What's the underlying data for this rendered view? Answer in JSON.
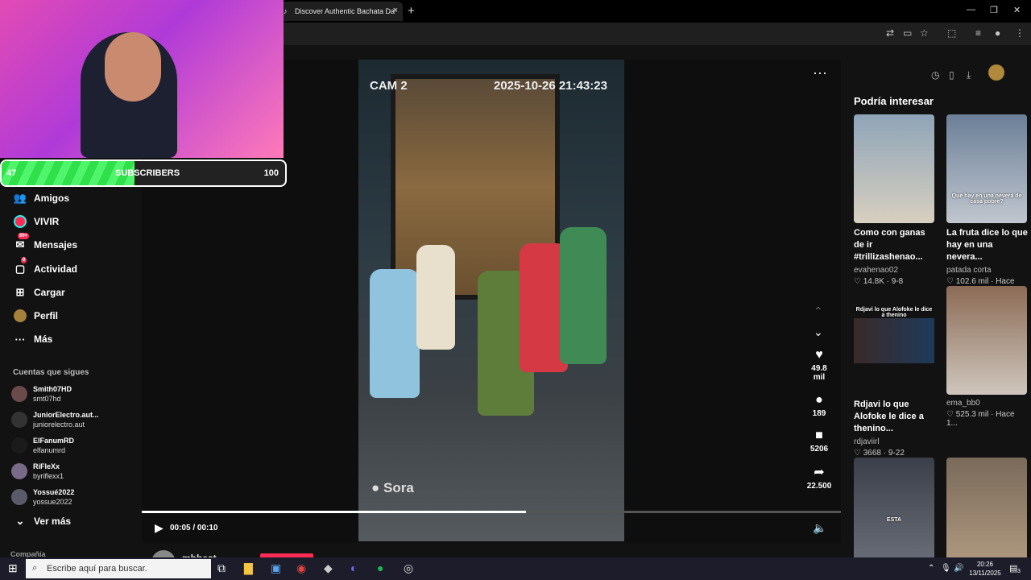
{
  "browser": {
    "tab_title": "Discover Authentic Bachata Da",
    "tab_close": "×",
    "new_tab": "+"
  },
  "sidebar": {
    "items": [
      {
        "label": "Amigos",
        "icon": "friends-icon"
      },
      {
        "label": "VIVIR",
        "icon": "live-icon"
      },
      {
        "label": "Mensajes",
        "icon": "messages-icon",
        "badge": "99+"
      },
      {
        "label": "Actividad",
        "icon": "activity-icon",
        "badge": "8"
      },
      {
        "label": "Cargar",
        "icon": "upload-icon"
      },
      {
        "label": "Perfil",
        "icon": "profile-icon"
      },
      {
        "label": "Más",
        "icon": "more-icon"
      }
    ],
    "following_heading": "Cuentas que sigues",
    "accounts": [
      {
        "name": "Smith07HD",
        "handle": "smt07hd"
      },
      {
        "name": "JuniorElectro.aut...",
        "handle": "juniorelectro.aut"
      },
      {
        "name": "ElFanumRD",
        "handle": "elfanumrd"
      },
      {
        "name": "RiFleXx",
        "handle": "byriflexx1"
      },
      {
        "name": "Yossué2022",
        "handle": "yossue2022"
      }
    ],
    "see_more": "Ver más",
    "footer": "Compañía"
  },
  "video": {
    "cam_label": "CAM 2",
    "timestamp": "2025-10-26 21:43:23",
    "watermark": "Sora",
    "likes": "49.8\nmil",
    "comments": "189",
    "saves": "5206",
    "shares": "22.500",
    "current_time": "00:05",
    "duration": "00:10",
    "time_display": "00:05 / 00:10",
    "progress": 0.55,
    "creator": "mbbeat"
  },
  "right_panel": {
    "heading": "Podría interesar",
    "cards": [
      {
        "title": "Como con ganas de ir #trillizashenao...",
        "author": "evahenao02",
        "stats": "♡ 14.8K · 9-8",
        "overlay": "",
        "color": "#8ea4b8"
      },
      {
        "title": "La fruta dice lo que hay en una nevera...",
        "author": "patada corta",
        "stats": "♡ 102.6 mil · Hace 1...",
        "overlay": "Que hay en una nevera de casa pobre?",
        "color": "#6b7f97"
      },
      {
        "title": "Rdjavi lo que Alofoke le dice a thenino...",
        "author": "rdjaviirl",
        "stats": "♡ 3668 · 9-22",
        "overlay": "Rdjavi lo que Alofoke le dice a thenino",
        "color": "#2a2a2a"
      },
      {
        "title": "",
        "author": "ema_bb0",
        "stats": "♡ 525.3 mil · Hace 1...",
        "overlay": "",
        "color": "#8b6b55"
      },
      {
        "title": "",
        "author": "",
        "stats": "",
        "overlay": "ESTA",
        "color": "#3a3f4a"
      },
      {
        "title": "",
        "author": "",
        "stats": "",
        "overlay": "",
        "color": "#7a6a5a"
      }
    ]
  },
  "stream_overlay": {
    "subscribers_label": "SUBSCRIBERS",
    "current": "47",
    "goal": "100",
    "fraction": 0.47
  },
  "taskbar": {
    "search_placeholder": "Escribe aquí para buscar.",
    "time": "20:26",
    "date": "13/11/2025",
    "notifications": "3"
  }
}
